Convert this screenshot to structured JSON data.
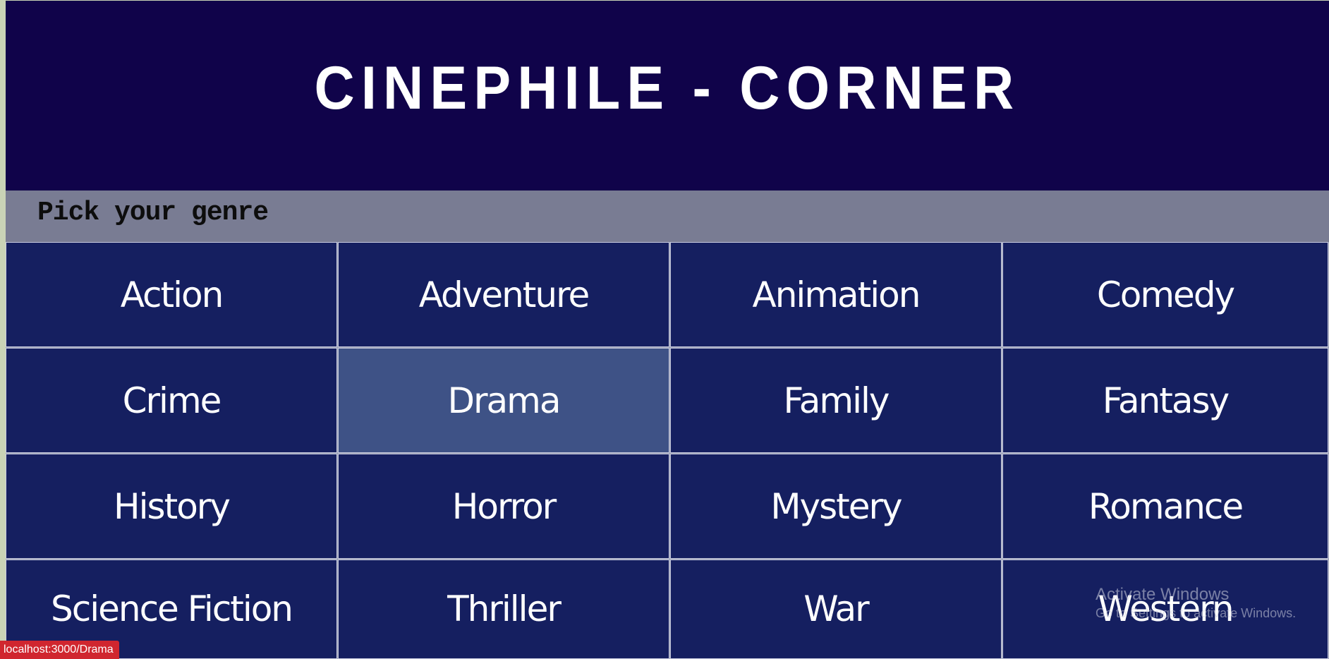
{
  "header": {
    "title": "CINEPHILE - CORNER"
  },
  "genre_section": {
    "heading": "Pick your genre"
  },
  "genres": [
    {
      "label": "Action"
    },
    {
      "label": "Adventure"
    },
    {
      "label": "Animation"
    },
    {
      "label": "Comedy"
    },
    {
      "label": "Crime"
    },
    {
      "label": "Drama"
    },
    {
      "label": "Family"
    },
    {
      "label": "Fantasy"
    },
    {
      "label": "History"
    },
    {
      "label": "Horror"
    },
    {
      "label": "Mystery"
    },
    {
      "label": "Romance"
    },
    {
      "label": "Science Fiction"
    },
    {
      "label": "Thriller"
    },
    {
      "label": "War"
    },
    {
      "label": "Western"
    }
  ],
  "hovered_genre": "Drama",
  "status_bar": {
    "url": "localhost:3000/Drama"
  },
  "os_watermark": {
    "title": "Activate Windows",
    "subtitle": "Go to Settings to activate Windows."
  },
  "colors": {
    "header_bg": "#10034a",
    "genre_bar_bg": "#797c93",
    "tile_bg": "#151f60",
    "tile_hover_bg": "#3e5286",
    "status_bg": "#d0262f"
  }
}
